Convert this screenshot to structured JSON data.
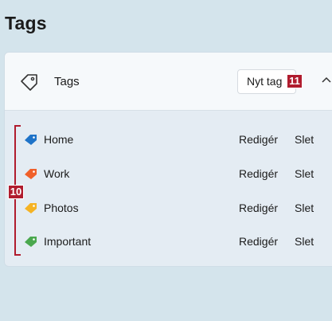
{
  "page": {
    "title": "Tags"
  },
  "section": {
    "header_label": "Tags",
    "new_tag_label": "Nyt tag"
  },
  "annotations": {
    "badge_new": "11",
    "badge_list": "10"
  },
  "colors": {
    "annotation": "#b01c2e"
  },
  "tags": [
    {
      "name": "Home",
      "color": "#1e73c8",
      "edit_label": "Redigér",
      "delete_label": "Slet"
    },
    {
      "name": "Work",
      "color": "#f0602a",
      "edit_label": "Redigér",
      "delete_label": "Slet"
    },
    {
      "name": "Photos",
      "color": "#f5b324",
      "edit_label": "Redigér",
      "delete_label": "Slet"
    },
    {
      "name": "Important",
      "color": "#4aa84e",
      "edit_label": "Redigér",
      "delete_label": "Slet"
    }
  ],
  "icons": {
    "section": "tag-outline-icon",
    "collapse": "chevron-up-icon",
    "row": "tag-filled-icon"
  }
}
